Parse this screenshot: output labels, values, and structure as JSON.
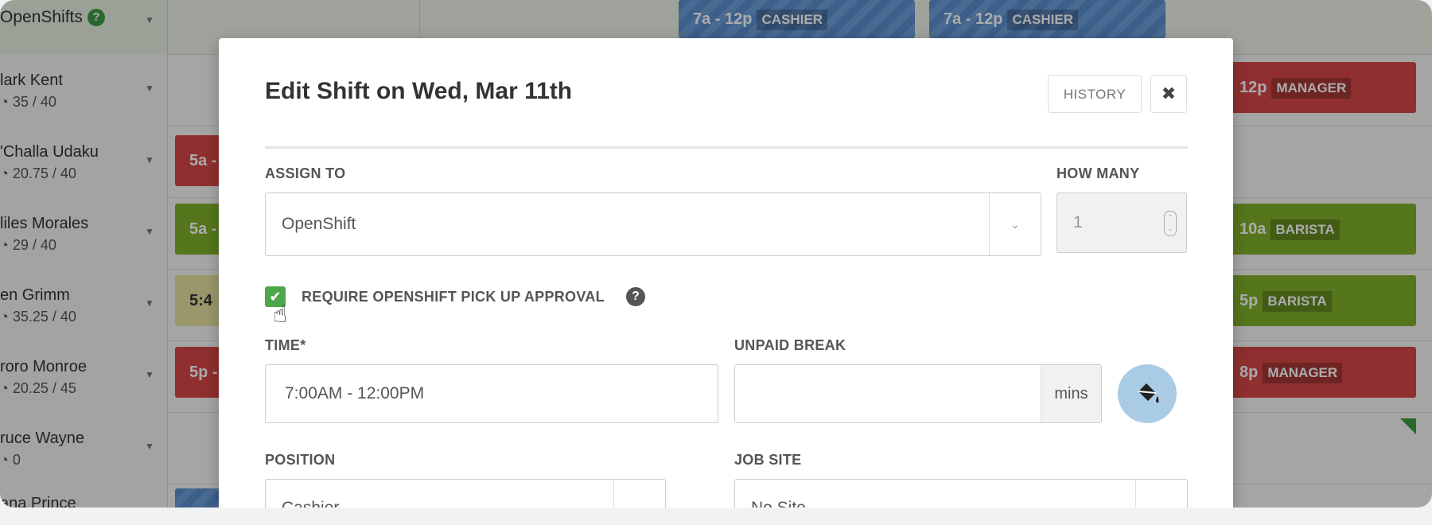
{
  "schedule": {
    "open_shifts": {
      "title": "OpenShifts",
      "help": "?"
    },
    "employees": [
      {
        "name": "lark Kent",
        "hours": "35 / 40"
      },
      {
        "name": "'Challa Udaku",
        "hours": "20.75 / 40"
      },
      {
        "name": "liles Morales",
        "hours": "29 / 40"
      },
      {
        "name": "en Grimm",
        "hours": "35.25 / 40"
      },
      {
        "name": "roro Monroe",
        "hours": "20.25 / 45"
      },
      {
        "name": "ruce Wayne",
        "hours": "0"
      },
      {
        "name": "ana Prince",
        "hours": ""
      }
    ],
    "shifts": [
      {
        "time": "7a - 12p",
        "tag": "CASHIER"
      },
      {
        "time": "7a - 12p",
        "tag": "CASHIER"
      },
      {
        "time": "12p",
        "tag": "MANAGER"
      },
      {
        "time": "5a -",
        "tag": ""
      },
      {
        "time": "5a -",
        "tag": ""
      },
      {
        "time": "10a",
        "tag": "BARISTA"
      },
      {
        "time": "5:4",
        "tag": ""
      },
      {
        "time": "5p",
        "tag": "BARISTA"
      },
      {
        "time": "5p -",
        "tag": ""
      },
      {
        "time": "8p",
        "tag": "MANAGER"
      }
    ],
    "colors": {
      "red": "#d54747",
      "green": "#7fb02a",
      "yellow": "#e6e1a0",
      "blue": "#5a8ed0"
    }
  },
  "modal": {
    "title": "Edit Shift on Wed, Mar 11th",
    "history_label": "HISTORY",
    "close_icon": "✖",
    "assign_to": {
      "label": "ASSIGN TO",
      "value": "OpenShift"
    },
    "how_many": {
      "label": "HOW MANY",
      "value": "1"
    },
    "approval": {
      "label": "REQUIRE OPENSHIFT PICK UP APPROVAL",
      "checked": true
    },
    "time": {
      "label": "TIME",
      "required_mark": "*",
      "value": "7:00AM - 12:00PM"
    },
    "unpaid_break": {
      "label": "UNPAID BREAK",
      "value": "",
      "unit": "mins"
    },
    "position": {
      "label": "POSITION",
      "value": "Cashier"
    },
    "job_site": {
      "label": "JOB SITE",
      "value": "No Site"
    },
    "accent": "#4ea64a"
  }
}
